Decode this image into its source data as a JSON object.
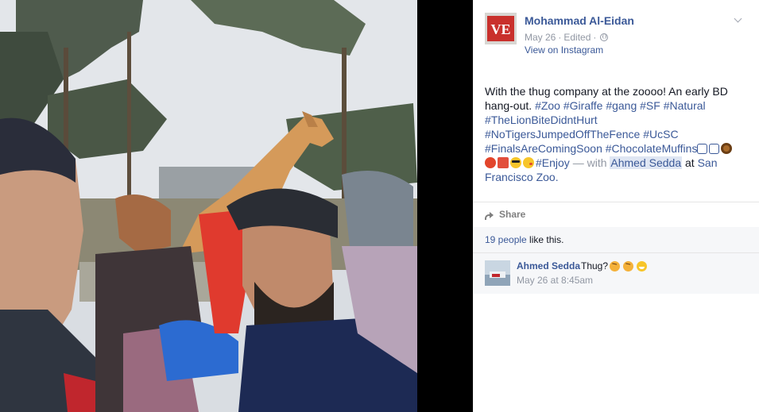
{
  "post": {
    "author": "Mohammad Al-Eidan",
    "date": "May 26",
    "separator": "·",
    "edited": "Edited",
    "view_on_instagram": "View on Instagram",
    "avatar_text": "VE"
  },
  "caption": {
    "text_prefix": "With the thug company at the zoooo! An early BD hang-out.",
    "hashtags_line1": [
      "#Zoo",
      "#Giraffe",
      "#gang",
      "#SF",
      "#Natural"
    ],
    "hashtags_line2": [
      "#TheLionBiteDidntHurt"
    ],
    "hashtags_line3": [
      "#NoTigersJumpedOffTheFence",
      "#UcSC"
    ],
    "hashtags_line4": [
      "#FinalsAreComingSoon",
      "#ChocolateMuffins"
    ],
    "enjoy_tag": "#Enjoy",
    "with_text": "— with",
    "tagged_person": "Ahmed Sedda",
    "at_text": "at",
    "location": "San Francisco Zoo."
  },
  "actions": {
    "share_label": "Share"
  },
  "likes": {
    "count_text": "19 people",
    "suffix": " like this."
  },
  "comments": [
    {
      "author": "Ahmed Sedda",
      "text": "Thug?",
      "time": "May 26 at 8:45am"
    }
  ],
  "colors": {
    "link": "#3b5998",
    "muted": "#9197a3",
    "panel_bg": "#ffffff",
    "comment_bg": "#f6f7f9"
  }
}
